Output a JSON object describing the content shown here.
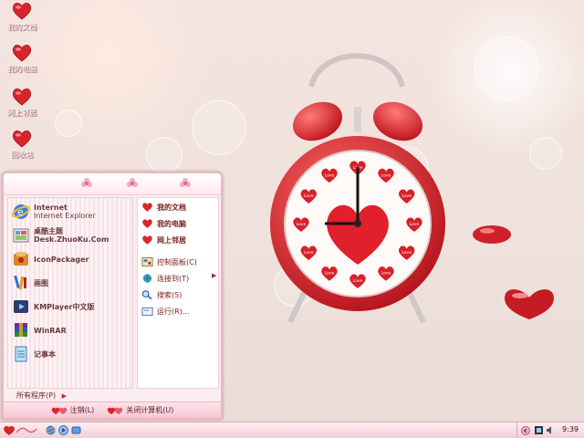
{
  "desktop_icons": [
    {
      "label": "我的文档",
      "icon": "heart-icon"
    },
    {
      "label": "我的电脑",
      "icon": "heart-icon"
    },
    {
      "label": "网上邻居",
      "icon": "heart-icon"
    },
    {
      "label": "回收站",
      "icon": "heart-icon"
    }
  ],
  "clock_face": {
    "heart_label": "Love",
    "time": "9:00"
  },
  "start_menu": {
    "left_items": [
      {
        "title": "Internet",
        "subtitle": "Internet Explorer",
        "icon": "ie-icon"
      },
      {
        "title": "桌酷主题",
        "subtitle": "Desk.ZhuoKu.Com",
        "icon": "theme-icon"
      },
      {
        "title": "IconPackager",
        "subtitle": "",
        "icon": "iconpackager-icon"
      },
      {
        "title": "画图",
        "subtitle": "",
        "icon": "paint-icon"
      },
      {
        "title": "KMPlayer中文版",
        "subtitle": "",
        "icon": "kmplayer-icon"
      },
      {
        "title": "WinRAR",
        "subtitle": "",
        "icon": "winrar-icon"
      },
      {
        "title": "记事本",
        "subtitle": "",
        "icon": "notepad-icon"
      }
    ],
    "all_programs": "所有程序(P)",
    "right_items": [
      {
        "label": "我的文档",
        "bold": true,
        "icon": "heart-icon"
      },
      {
        "label": "我的电脑",
        "bold": true,
        "icon": "heart-icon"
      },
      {
        "label": "网上邻居",
        "bold": true,
        "icon": "heart-icon"
      },
      {
        "label": "控制面板(C)",
        "bold": false,
        "icon": "control-panel-icon"
      },
      {
        "label": "连接到(T)",
        "bold": false,
        "icon": "connect-icon"
      },
      {
        "label": "搜索(S)",
        "bold": false,
        "icon": "search-icon"
      },
      {
        "label": "运行(R)...",
        "bold": false,
        "icon": "run-icon"
      }
    ],
    "logoff": "注销(L)",
    "shutdown": "关闭计算机(U)"
  },
  "taskbar": {
    "clock": "9:39"
  },
  "colors": {
    "accent": "#d8252c",
    "menu_border": "#e7b9c2",
    "taskbar": "#f2cfd8"
  }
}
